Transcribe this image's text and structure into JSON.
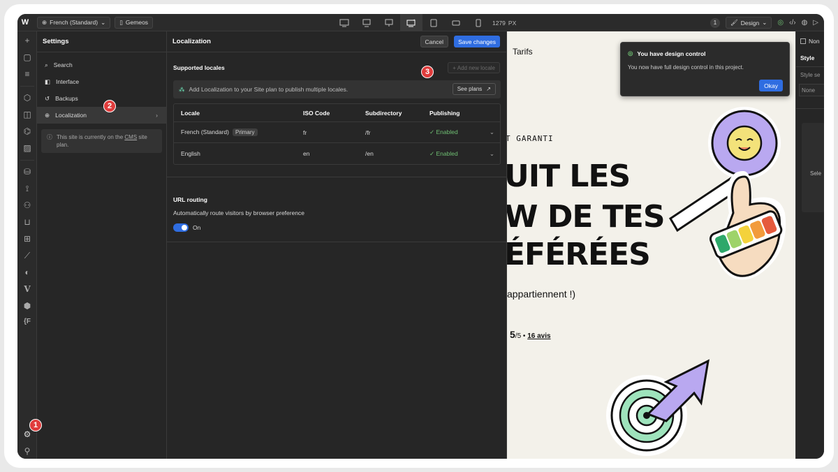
{
  "topbar": {
    "logo": "W",
    "locale_selector": "French (Standard)",
    "page_name": "Gemeos",
    "width_value": "1279",
    "width_unit": "PX",
    "collaborators_count": "1",
    "mode": "Design"
  },
  "settings": {
    "title": "Settings",
    "items": [
      {
        "label": "Search",
        "icon": "search-icon"
      },
      {
        "label": "Interface",
        "icon": "interface-icon"
      },
      {
        "label": "Backups",
        "icon": "backup-icon"
      },
      {
        "label": "Localization",
        "icon": "globe-icon"
      }
    ],
    "notice_pre": "This site is currently on the ",
    "notice_link": "CMS",
    "notice_post": " site plan."
  },
  "localization": {
    "title": "Localization",
    "cancel_label": "Cancel",
    "save_label": "Save changes",
    "supported_locales_title": "Supported locales",
    "add_locale_label": "+ Add new locale",
    "banner_text": "Add Localization to your Site plan to publish multiple locales.",
    "see_plans_label": "See plans",
    "columns": [
      "Locale",
      "ISO Code",
      "Subdirectory",
      "Publishing"
    ],
    "rows": [
      {
        "locale": "French (Standard)",
        "tag": "Primary",
        "iso": "fr",
        "subdir": "/fr",
        "publishing": "Enabled"
      },
      {
        "locale": "English",
        "tag": "",
        "iso": "en",
        "subdir": "/en",
        "publishing": "Enabled"
      }
    ],
    "url_routing_title": "URL routing",
    "url_routing_desc": "Automatically route visitors by browser preference",
    "toggle_label": "On",
    "toggle_on": true
  },
  "canvas": {
    "nav_link": "Tarifs",
    "tagline": "T GARANTI",
    "headline_1": "UIT LES",
    "headline_2": "W DE TES",
    "headline_3": "ÉFÉRÉES",
    "subtext": "appartiennent !)",
    "rating": "5",
    "rating_suffix": "/5 • ",
    "reviews_link": "16 avis"
  },
  "toast": {
    "title": "You have design control",
    "body": "You now have full design control in this project.",
    "button": "Okay"
  },
  "right_panel": {
    "checkbox_label": "Non",
    "tab_style": "Style",
    "style_label": "Style se",
    "style_value": "None",
    "select_label": "Sele"
  },
  "markers": [
    "1",
    "2",
    "3"
  ],
  "colors": {
    "accent": "#2f6de1",
    "enabled": "#6fbf73",
    "marker": "#e03c3c"
  }
}
